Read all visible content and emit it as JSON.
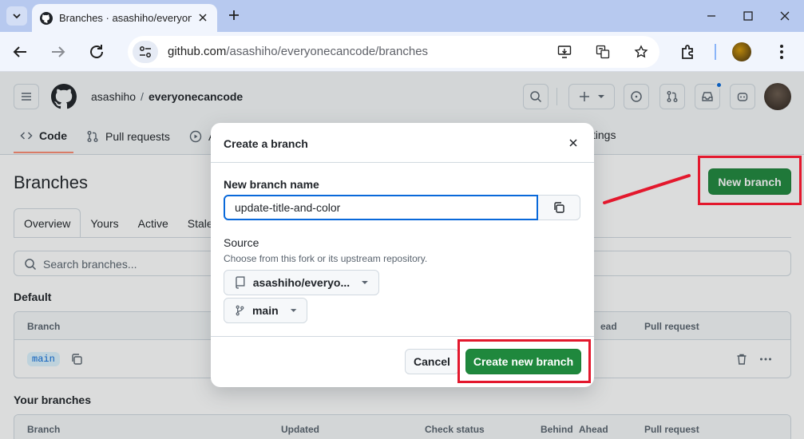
{
  "browser": {
    "tab_title": "Branches · asashiho/everyone",
    "url_host": "github.com",
    "url_path": "/asashiho/everyonecancode/branches"
  },
  "header": {
    "owner": "asashiho",
    "separator": "/",
    "repo": "everyonecancode"
  },
  "repo_nav": {
    "code": "Code",
    "pull_requests": "Pull requests",
    "issues_partial": "A",
    "settings_partial": "ttings"
  },
  "page": {
    "title": "Branches",
    "new_branch_label": "New branch",
    "tabs": [
      "Overview",
      "Yours",
      "Active",
      "Stale"
    ],
    "search_placeholder": "Search branches..."
  },
  "default_section": {
    "heading": "Default",
    "col_branch": "Branch",
    "col_ahead_partial": "ead",
    "col_pull_request": "Pull request",
    "branch_name": "main"
  },
  "your_branches": {
    "heading": "Your branches",
    "col_branch": "Branch",
    "col_updated": "Updated",
    "col_check_status": "Check status",
    "col_behind": "Behind",
    "col_ahead": "Ahead",
    "col_pull_request": "Pull request"
  },
  "dialog": {
    "title": "Create a branch",
    "name_label": "New branch name",
    "name_value": "update-title-and-color",
    "source_label": "Source",
    "source_caption": "Choose from this fork or its upstream repository.",
    "repo_select": "asashiho/everyo...",
    "branch_select": "main",
    "cancel_label": "Cancel",
    "create_label": "Create new branch"
  },
  "colors": {
    "primary_green": "#1f883d",
    "annotation_red": "#e3182d",
    "focus_blue": "#0969da"
  }
}
